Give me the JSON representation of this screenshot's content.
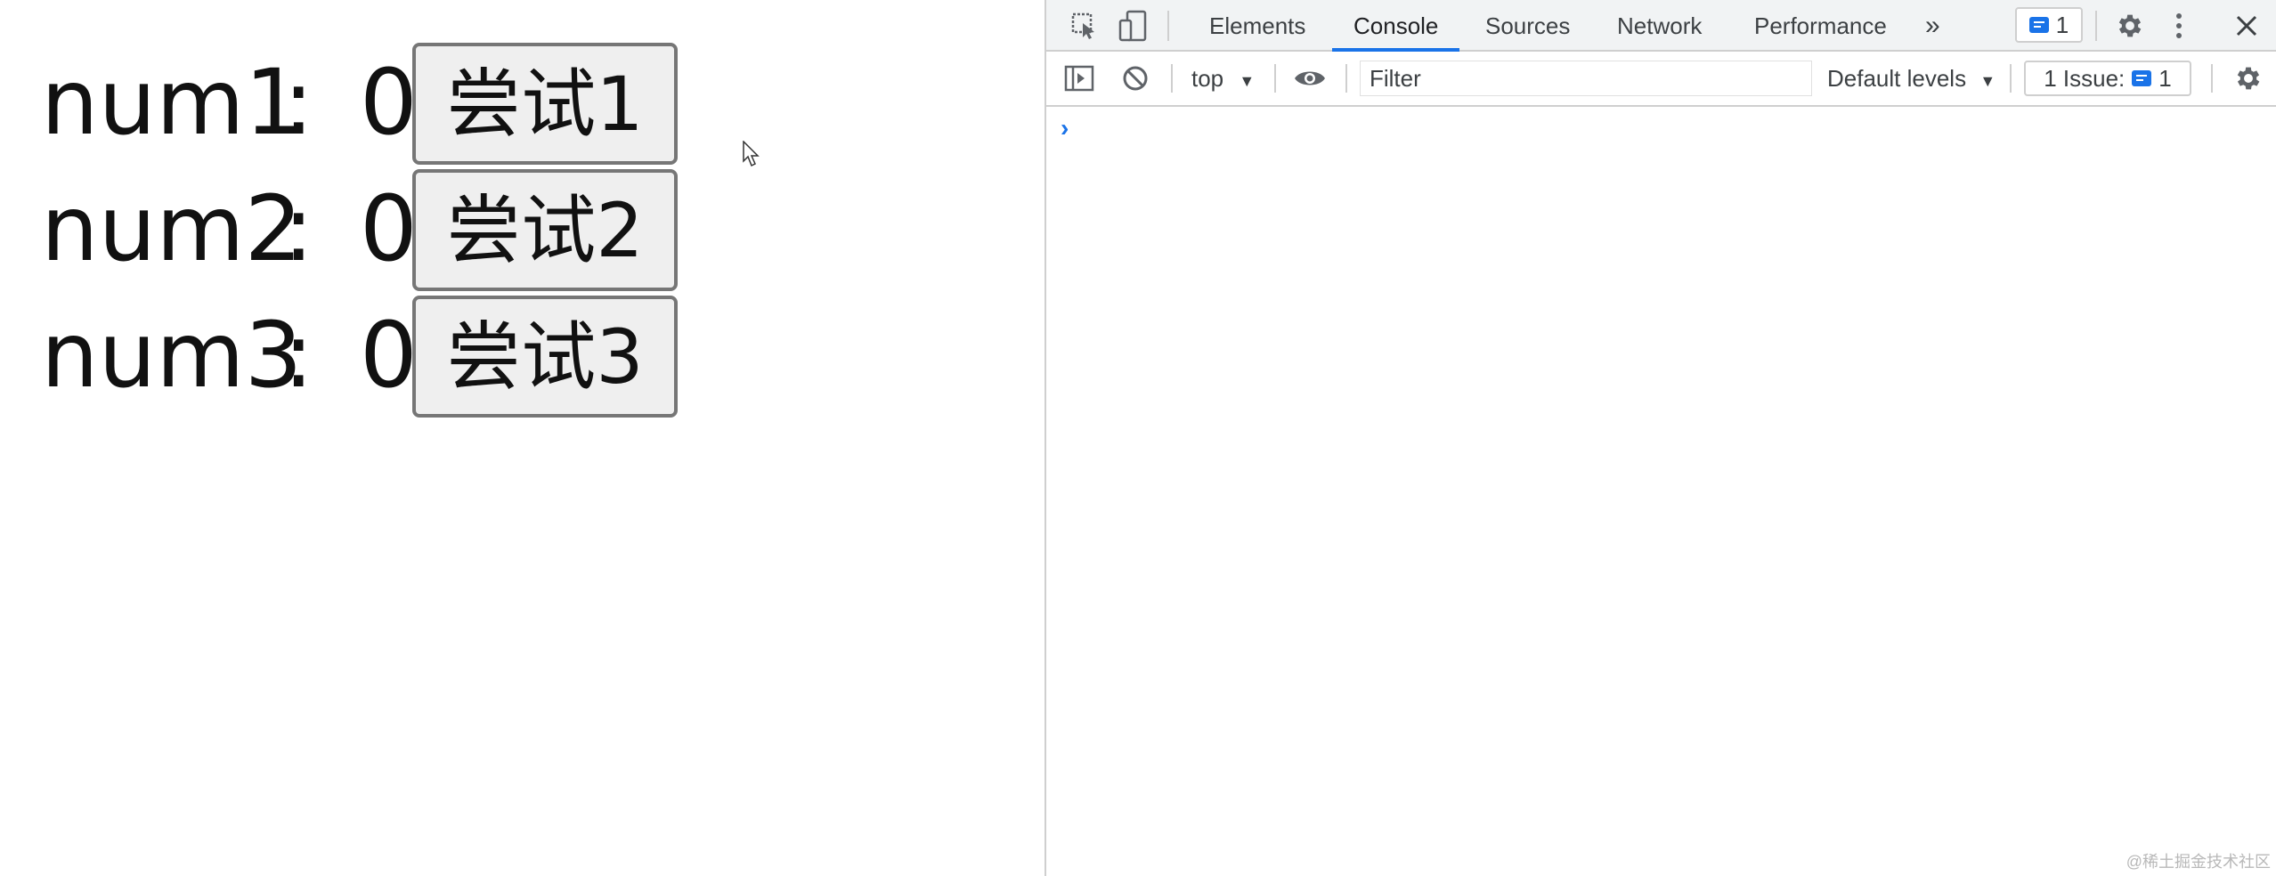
{
  "page": {
    "rows": [
      {
        "label": "num1",
        "colon": ":",
        "value": "0",
        "button": "尝试1"
      },
      {
        "label": "num2",
        "colon": ":",
        "value": "0",
        "button": "尝试2"
      },
      {
        "label": "num3",
        "colon": ":",
        "value": "0",
        "button": "尝试3"
      }
    ]
  },
  "devtools": {
    "tabs": [
      "Elements",
      "Console",
      "Sources",
      "Network",
      "Performance"
    ],
    "active_tab": "Console",
    "more_tabs": "»",
    "message_badge_count": "1",
    "console_toolbar": {
      "context": "top",
      "filter_placeholder": "Filter",
      "levels": "Default levels",
      "issues_label": "1 Issue:",
      "issues_count": "1"
    },
    "prompt": "›"
  },
  "watermark": "@稀土掘金技术社区",
  "colors": {
    "accent": "#1a73e8",
    "toolbar_bg": "#f1f3f4",
    "button_bg": "#efefef",
    "button_border": "#767676"
  }
}
